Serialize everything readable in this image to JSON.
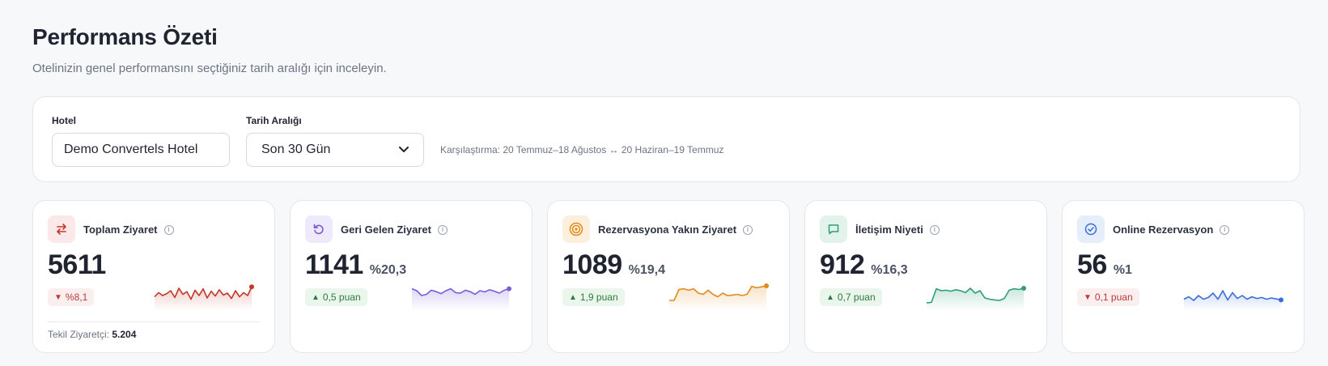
{
  "header": {
    "title": "Performans Özeti",
    "subtitle": "Otelinizin genel performansını seçtiğiniz tarih aralığı için inceleyin."
  },
  "filters": {
    "hotel_label": "Hotel",
    "hotel_value": "Demo Convertels Hotel",
    "date_label": "Tarih Aralığı",
    "date_value": "Son 30 Gün",
    "comparison": "Karşılaştırma: 20 Temmuz–18 Ağustos ↔ 20 Haziran–19 Temmuz"
  },
  "kpis": [
    {
      "title": "Toplam Ziyaret",
      "icon": "swap-arrows-icon",
      "value": "5611",
      "rate": "",
      "delta": "%8,1",
      "delta_dir": "down",
      "delta_arrow": "▼",
      "color": "#c0392b",
      "icon_bg": "#fbe9e9",
      "unique_label": "Tekil Ziyaretçi:",
      "unique_value": "5.204",
      "spark": [
        0.45,
        0.62,
        0.5,
        0.58,
        0.7,
        0.42,
        0.8,
        0.55,
        0.66,
        0.35,
        0.72,
        0.5,
        0.78,
        0.4,
        0.68,
        0.48,
        0.74,
        0.52,
        0.6,
        0.38,
        0.7,
        0.45,
        0.62,
        0.5,
        0.86
      ]
    },
    {
      "title": "Geri Gelen Ziyaret",
      "icon": "refresh-icon",
      "value": "1141",
      "rate": "%20,3",
      "delta": "0,5 puan",
      "delta_dir": "up",
      "delta_arrow": "▲",
      "color": "#7c5cd6",
      "icon_bg": "#eee9fb",
      "spark": [
        0.78,
        0.7,
        0.5,
        0.55,
        0.72,
        0.66,
        0.58,
        0.7,
        0.78,
        0.62,
        0.6,
        0.72,
        0.66,
        0.55,
        0.7,
        0.65,
        0.74,
        0.68,
        0.6,
        0.72,
        0.78
      ]
    },
    {
      "title": "Rezervasyona Yakın Ziyaret",
      "icon": "target-icon",
      "value": "1089",
      "rate": "%19,4",
      "delta": "1,9 puan",
      "delta_dir": "up",
      "delta_arrow": "▲",
      "color": "#e08b1e",
      "icon_bg": "#fcefdc",
      "spark": [
        0.3,
        0.3,
        0.75,
        0.78,
        0.72,
        0.78,
        0.6,
        0.55,
        0.72,
        0.55,
        0.45,
        0.6,
        0.5,
        0.52,
        0.55,
        0.5,
        0.55,
        0.88,
        0.82,
        0.86,
        0.9
      ]
    },
    {
      "title": "İletişim Niyeti",
      "icon": "chat-icon",
      "value": "912",
      "rate": "%16,3",
      "delta": "0,7 puan",
      "delta_dir": "up",
      "delta_arrow": "▲",
      "color": "#2f9e7a",
      "icon_bg": "#e2f3ec",
      "spark": [
        0.2,
        0.22,
        0.78,
        0.7,
        0.72,
        0.68,
        0.74,
        0.7,
        0.62,
        0.8,
        0.6,
        0.7,
        0.4,
        0.35,
        0.32,
        0.3,
        0.38,
        0.72,
        0.78,
        0.75,
        0.8
      ]
    },
    {
      "title": "Online Rezervasyon",
      "icon": "check-circle-icon",
      "value": "56",
      "rate": "%1",
      "delta": "0,1 puan",
      "delta_dir": "down",
      "delta_arrow": "▼",
      "color": "#3c6ed8",
      "icon_bg": "#e6eefb",
      "spark": [
        0.35,
        0.45,
        0.3,
        0.5,
        0.35,
        0.42,
        0.6,
        0.35,
        0.7,
        0.32,
        0.62,
        0.38,
        0.5,
        0.35,
        0.45,
        0.38,
        0.42,
        0.35,
        0.4,
        0.36,
        0.32
      ]
    }
  ]
}
